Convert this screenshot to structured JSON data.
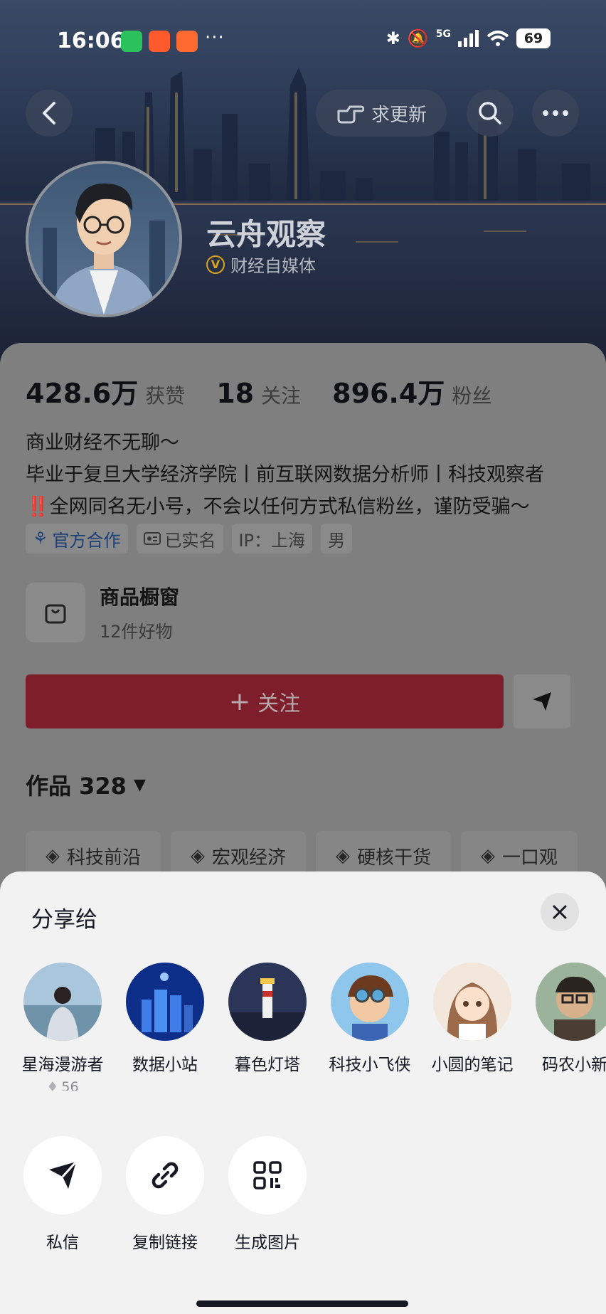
{
  "status_bar": {
    "time": "16:06",
    "battery": "69",
    "network": "5G",
    "notification_dots": "···"
  },
  "nav": {
    "request_update_label": "求更新"
  },
  "profile": {
    "name": "云舟观察",
    "verification": "财经自媒体",
    "verification_badge": "V",
    "stats": [
      {
        "value": "428.6万",
        "label": "获赞"
      },
      {
        "value": "18",
        "label": "关注"
      },
      {
        "value": "896.4万",
        "label": "粉丝"
      }
    ],
    "bio": "商业财经不无聊～\n毕业于复旦大学经济学院丨前互联网数据分析师丨科技观察者\n‼️全网同名无小号，不会以任何方式私信粉丝，谨防受骗～",
    "tags": [
      "官方合作",
      "已实名",
      "IP：上海",
      "男"
    ],
    "shop": {
      "title": "商品橱窗",
      "subtitle": "12件好物"
    },
    "follow_label": "关注",
    "follow_plus": "+",
    "works_label": "作品 328",
    "categories": [
      "科技前沿",
      "宏观经济",
      "硬核干货",
      "一口观"
    ]
  },
  "share_sheet": {
    "title": "分享给",
    "friends": [
      {
        "name": "星海漫游者",
        "sub": "56"
      },
      {
        "name": "数据小站",
        "sub": ""
      },
      {
        "name": "暮色灯塔",
        "sub": ""
      },
      {
        "name": "科技小飞侠",
        "sub": ""
      },
      {
        "name": "小圆的笔记",
        "sub": ""
      },
      {
        "name": "码农小新",
        "sub": ""
      }
    ],
    "actions": [
      {
        "label": "私信",
        "icon": "send-icon"
      },
      {
        "label": "复制链接",
        "icon": "link-icon"
      },
      {
        "label": "生成图片",
        "icon": "qr-code-icon"
      }
    ]
  },
  "colors": {
    "follow_button": "#7e1e2a",
    "sheet_bg": "#f2f2f2",
    "verified_gold": "#d8a21e"
  }
}
